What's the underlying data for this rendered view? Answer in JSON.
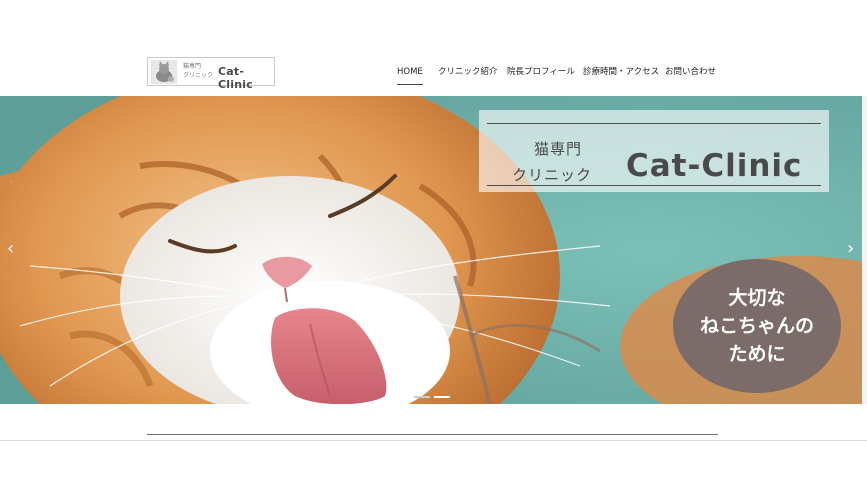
{
  "logo": {
    "line1": "猫専門",
    "line2": "クリニック",
    "name": "Cat-Clinic"
  },
  "nav": {
    "items": [
      {
        "label": "HOME",
        "active": true
      },
      {
        "label": "クリニック紹介",
        "active": false
      },
      {
        "label": "院長プロフィール",
        "active": false
      },
      {
        "label": "診療時間・アクセス",
        "active": false
      },
      {
        "label": "お問い合わせ",
        "active": false
      }
    ]
  },
  "hero": {
    "panel_line1": "猫専門",
    "panel_line2": "クリニック",
    "panel_name": "Cat-Clinic",
    "bubble_lines": [
      "大切な",
      "ねこちゃんの",
      "ために"
    ],
    "prev_icon": "chevron-left-icon",
    "next_icon": "chevron-right-icon",
    "slides_total": 2,
    "slide_active": 2
  },
  "colors": {
    "bubble": "#7c6c69",
    "background_teal": "#6fb3ab",
    "cat_orange": "#e09a52",
    "text_dark": "#4a4a4a"
  }
}
